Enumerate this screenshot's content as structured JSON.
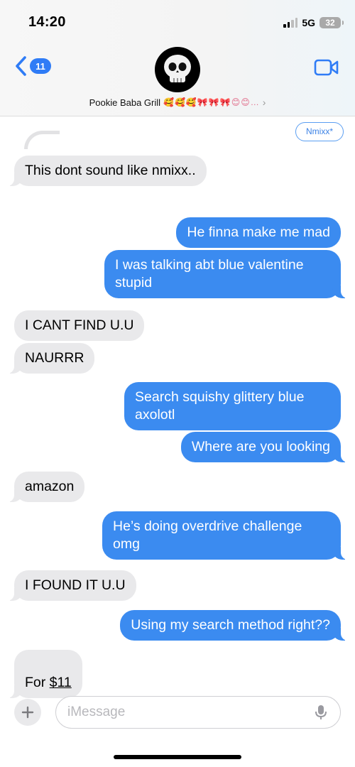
{
  "status": {
    "time": "14:20",
    "network": "5G",
    "battery": "32"
  },
  "header": {
    "back_count": "11",
    "contact_name": "Pookie Baba Grill",
    "contact_emojis": "🥰🥰🥰🎀🎀🎀😊😊…",
    "avatar_icon": "skull-icon"
  },
  "thread": {
    "reply_tag": "Nmixx*",
    "messages": [
      {
        "side": "in",
        "text": "This dont sound like nmixx.."
      },
      {
        "side": "out",
        "text": "He finna make me mad"
      },
      {
        "side": "out",
        "text": "I was talking abt blue valentine\nstupid"
      },
      {
        "side": "in",
        "text": "I CANT FIND U.U"
      },
      {
        "side": "in",
        "text": "NAURRR"
      },
      {
        "side": "out",
        "text": "Search squishy glittery blue\naxolotl"
      },
      {
        "side": "out",
        "text": "Where are you looking"
      },
      {
        "side": "in",
        "text": "amazon"
      },
      {
        "side": "out",
        "text": "He’s doing overdrive challenge\nomg"
      },
      {
        "side": "in",
        "text": "I FOUND IT U.U"
      },
      {
        "side": "out",
        "text": "Using my search method right??"
      },
      {
        "side": "in",
        "text_prefix": "For ",
        "text_link": "$11"
      }
    ]
  },
  "composer": {
    "placeholder": "iMessage"
  },
  "colors": {
    "outgoing": "#3b8bf0",
    "incoming": "#e9e9eb",
    "accent": "#2f7cf6"
  }
}
